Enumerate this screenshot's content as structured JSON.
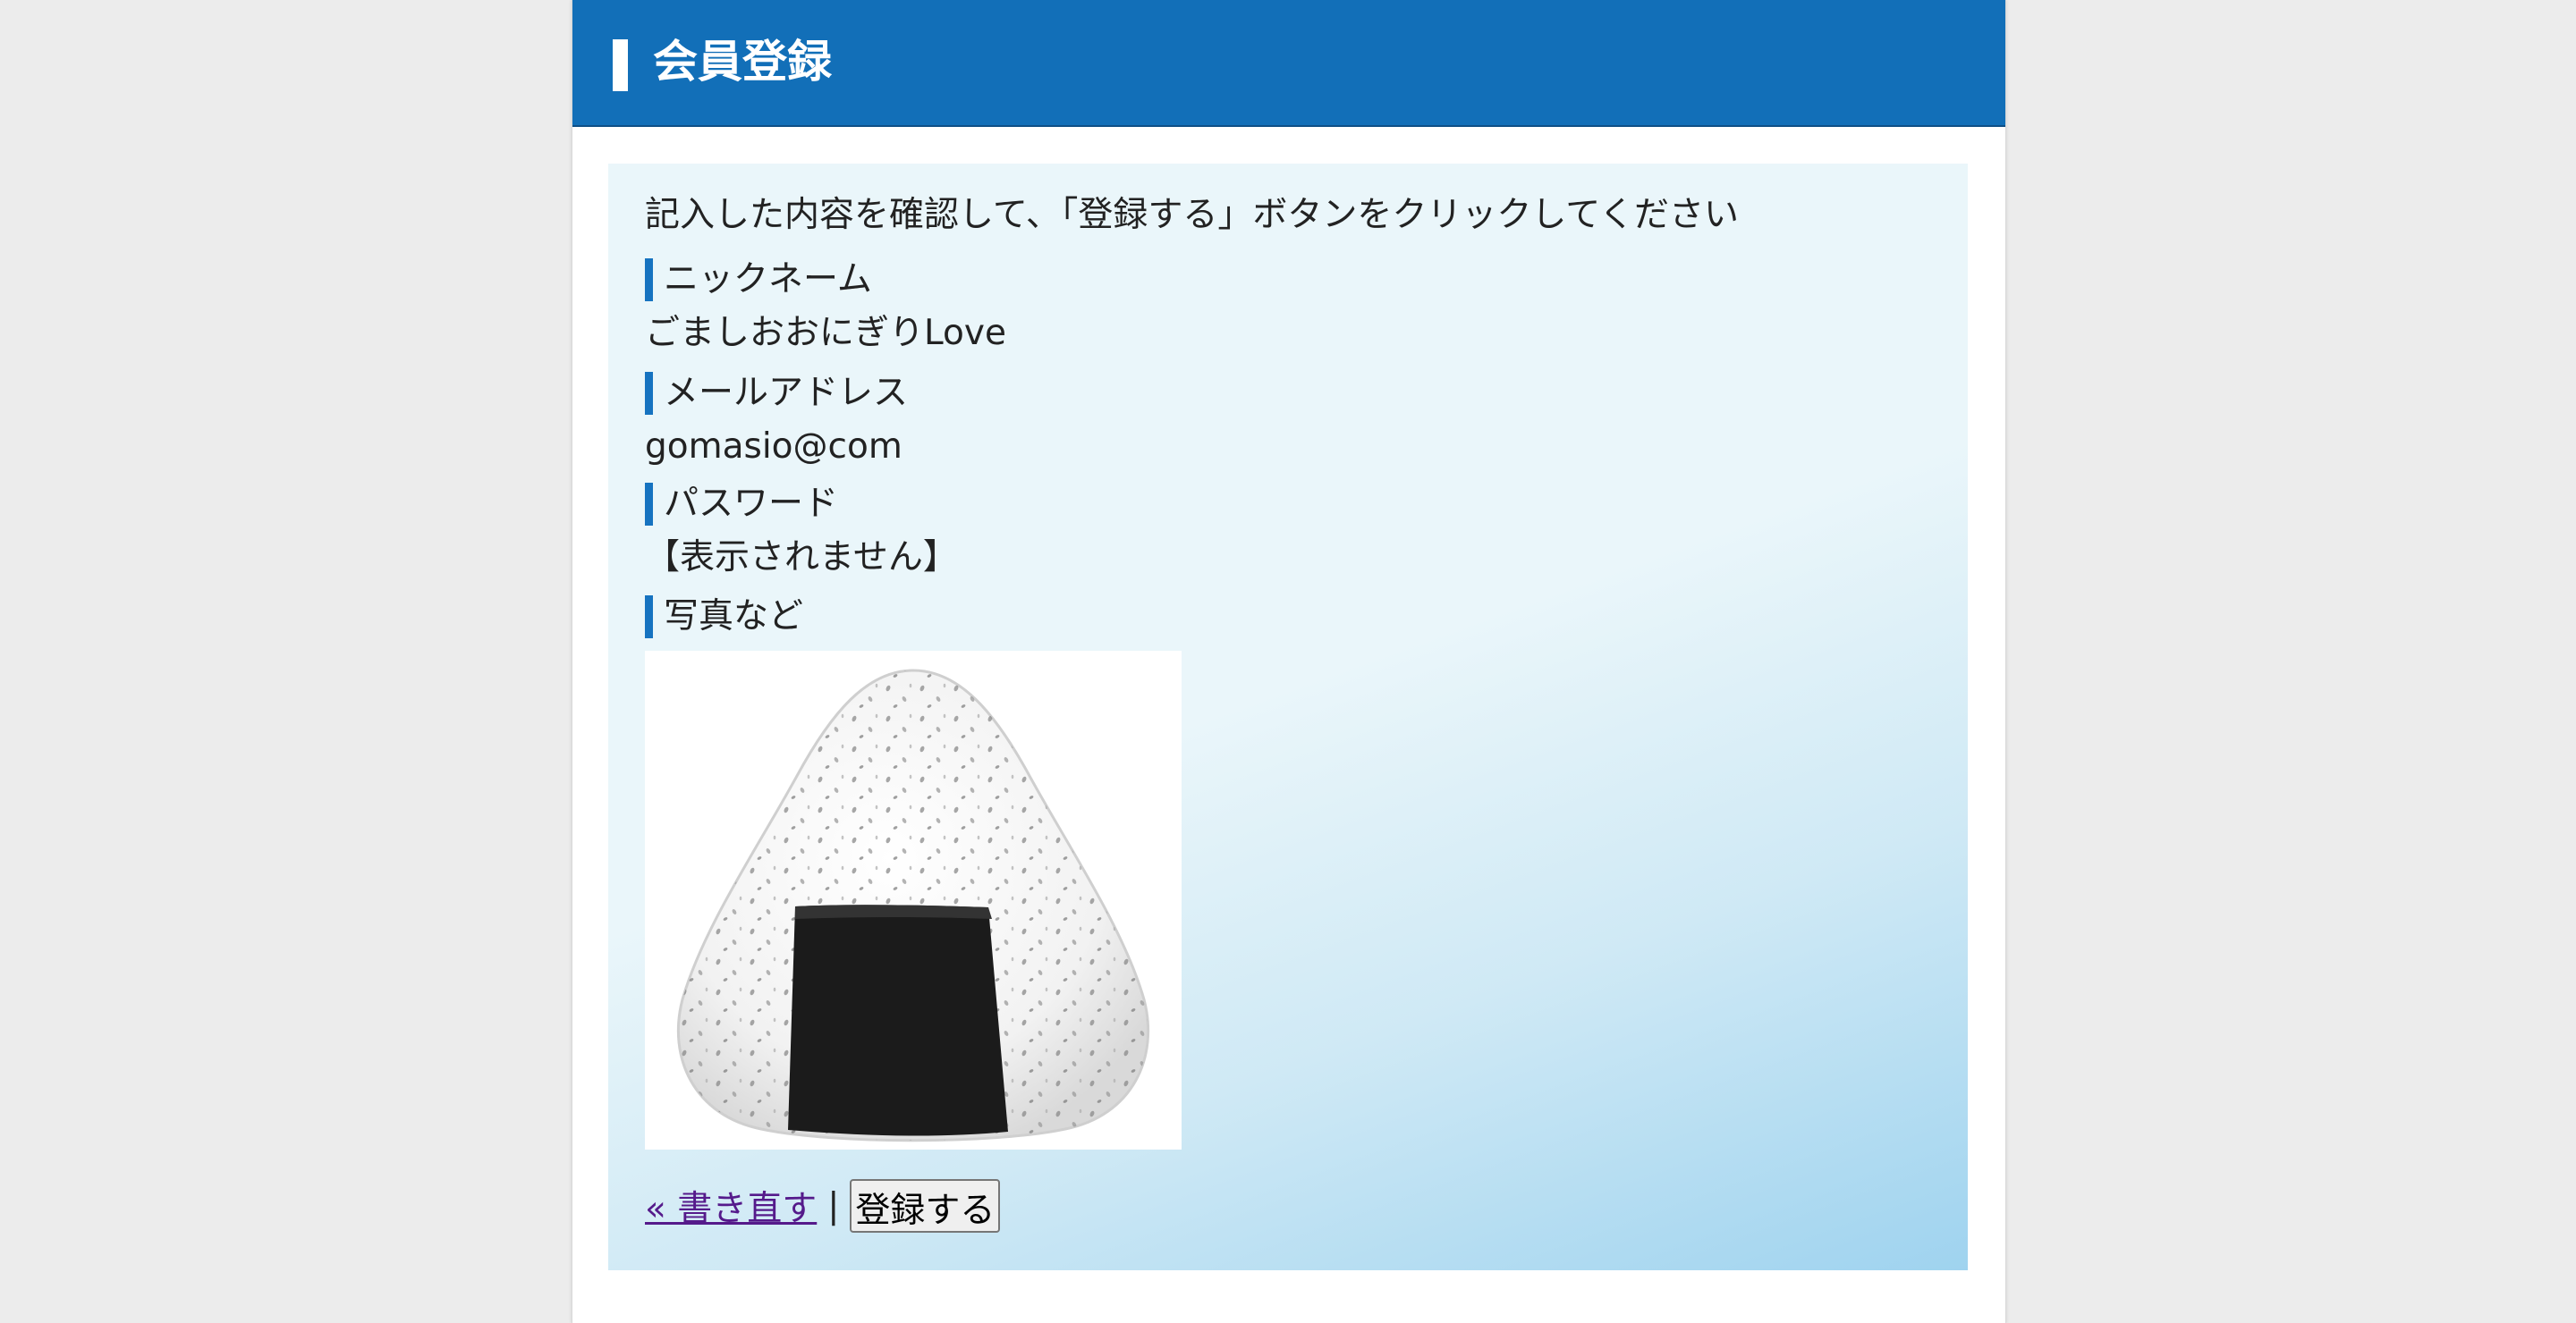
{
  "header": {
    "title": "会員登録"
  },
  "form": {
    "instruction": "記入した内容を確認して、「登録する」ボタンをクリックしてください",
    "fields": [
      {
        "label": "ニックネーム",
        "value": "ごましおおにぎりLove"
      },
      {
        "label": "メールアドレス",
        "value": "gomasio@com"
      },
      {
        "label": "パスワード",
        "value": "【表示されません】"
      },
      {
        "label": "写真など",
        "image": "onigiri-rice-ball-photo"
      }
    ]
  },
  "actions": {
    "rewrite_link": "« 書き直す",
    "separator": "|",
    "submit_label": "登録する"
  },
  "colors": {
    "header_bg": "#126fb8",
    "accent": "#1673c0",
    "panel_top": "#eaf6fa",
    "panel_bottom": "#9fd3ef",
    "link_visited": "#551a8b"
  }
}
